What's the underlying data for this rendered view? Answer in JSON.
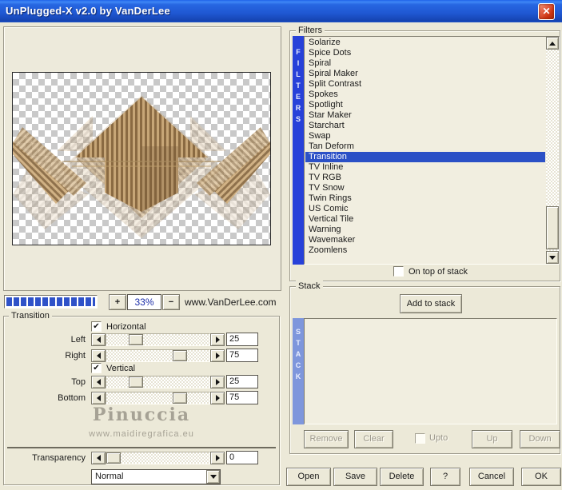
{
  "window": {
    "title": "UnPlugged-X v2.0 by VanDerLee"
  },
  "icons": {
    "close": "✕",
    "check": "✔"
  },
  "preview": {
    "zoom_in_label": "+",
    "zoom_level": "33%",
    "zoom_out_label": "−",
    "website": "www.VanDerLee.com"
  },
  "transition": {
    "group_label": "Transition",
    "horizontal_label": "Horizontal",
    "horizontal_checked": true,
    "vertical_label": "Vertical",
    "vertical_checked": true,
    "sliders": [
      {
        "label": "Left",
        "value": "25",
        "pos": 25
      },
      {
        "label": "Right",
        "value": "75",
        "pos": 75
      },
      {
        "label": "Top",
        "value": "25",
        "pos": 25
      },
      {
        "label": "Bottom",
        "value": "75",
        "pos": 75
      }
    ],
    "watermark": {
      "name": "Pinuccia",
      "site": "www.maidiregrafica.eu"
    },
    "transparency": {
      "label": "Transparency",
      "value": "0",
      "pos": 0
    },
    "blend_mode": "Normal"
  },
  "filters": {
    "group_label": "Filters",
    "sidebar_letters": [
      "F",
      "I",
      "L",
      "T",
      "E",
      "R",
      "S"
    ],
    "items": [
      "Solarize",
      "Spice Dots",
      "Spiral",
      "Spiral Maker",
      "Split Contrast",
      "Spokes",
      "Spotlight",
      "Star Maker",
      "Starchart",
      "Swap",
      "Tan Deform",
      "Transition",
      "TV Inline",
      "TV RGB",
      "TV Snow",
      "Twin Rings",
      "US Comic",
      "Vertical Tile",
      "Warning",
      "Wavemaker",
      "Zoomlens"
    ],
    "selected": "Transition",
    "on_top_label": "On top of stack",
    "on_top_checked": false
  },
  "stack": {
    "group_label": "Stack",
    "add_button": "Add to stack",
    "sidebar_letters": [
      "S",
      "T",
      "A",
      "C",
      "K"
    ],
    "remove_button": "Remove",
    "clear_button": "Clear",
    "upto_label": "Upto",
    "up_button": "Up",
    "down_button": "Down"
  },
  "actions": {
    "open": "Open",
    "save": "Save",
    "delete": "Delete",
    "help": "?",
    "cancel": "Cancel",
    "ok": "OK"
  },
  "colors": {
    "dialog_bg": "#ECE9D8",
    "titlebar_top": "#3F87F5",
    "titlebar_bottom": "#1644B2",
    "selection": "#2B50C6",
    "filters_bar": "#2741D9",
    "stack_bar": "#7E96DC",
    "progress": "#2F52C8",
    "close_red": "#CC3512"
  }
}
